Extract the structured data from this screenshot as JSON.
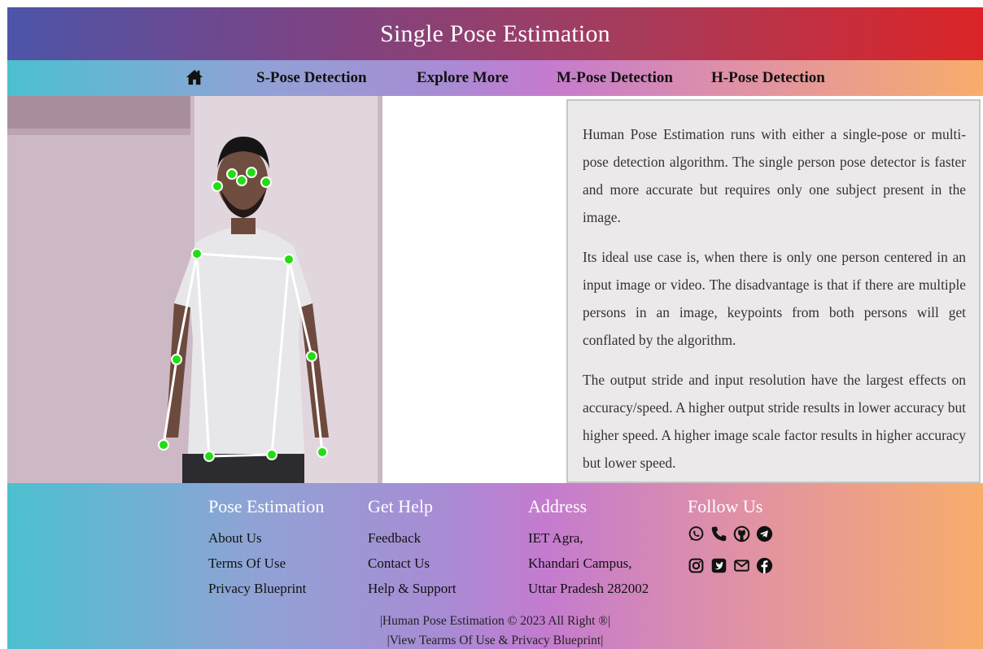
{
  "header": {
    "title": "Single Pose Estimation"
  },
  "nav": {
    "home_icon": "home-icon",
    "items": [
      {
        "label": "S-Pose Detection"
      },
      {
        "label": "Explore More"
      },
      {
        "label": "M-Pose Detection"
      },
      {
        "label": "H-Pose Detection"
      }
    ]
  },
  "description": {
    "paragraphs": [
      "Human Pose Estimation runs with either a single-pose or multi-pose detection algorithm. The single person pose detector is faster and more accurate but requires only one subject present in the image.",
      "Its ideal use case is, when there is only one person centered in an input image or video. The disadvantage is that if there are multiple persons in an image, keypoints from both persons will get conflated by the algorithm.",
      "The output stride and input resolution have the largest effects on accuracy/speed. A higher output stride results in lower accuracy but higher speed. A higher image scale factor results in higher accuracy but lower speed."
    ]
  },
  "footer": {
    "pose": {
      "heading": "Pose Estimation",
      "links": [
        "About Us",
        "Terms Of Use",
        "Privacy Blueprint"
      ]
    },
    "help": {
      "heading": "Get Help",
      "links": [
        "Feedback",
        "Contact Us",
        "Help & Support"
      ]
    },
    "address": {
      "heading": "Address",
      "lines": [
        "IET Agra,",
        "Khandari Campus,",
        "Uttar Pradesh 282002"
      ]
    },
    "follow": {
      "heading": "Follow Us",
      "icons": [
        "whatsapp-icon",
        "phone-icon",
        "github-icon",
        "telegram-icon",
        "instagram-icon",
        "twitter-icon",
        "email-icon",
        "facebook-icon"
      ]
    },
    "copyright": "|Human Pose Estimation © 2023 All Right ®|",
    "terms_line": "|View Tearms Of Use & Privacy Blueprint|"
  },
  "colors": {
    "keypoint": "#22dd11",
    "skeleton": "#ffffff",
    "title_gradient": [
      "#4d55a8",
      "#dc2427"
    ],
    "nav_gradient": [
      "#4cc0d0",
      "#c47bcf",
      "#f8ad6b"
    ]
  }
}
